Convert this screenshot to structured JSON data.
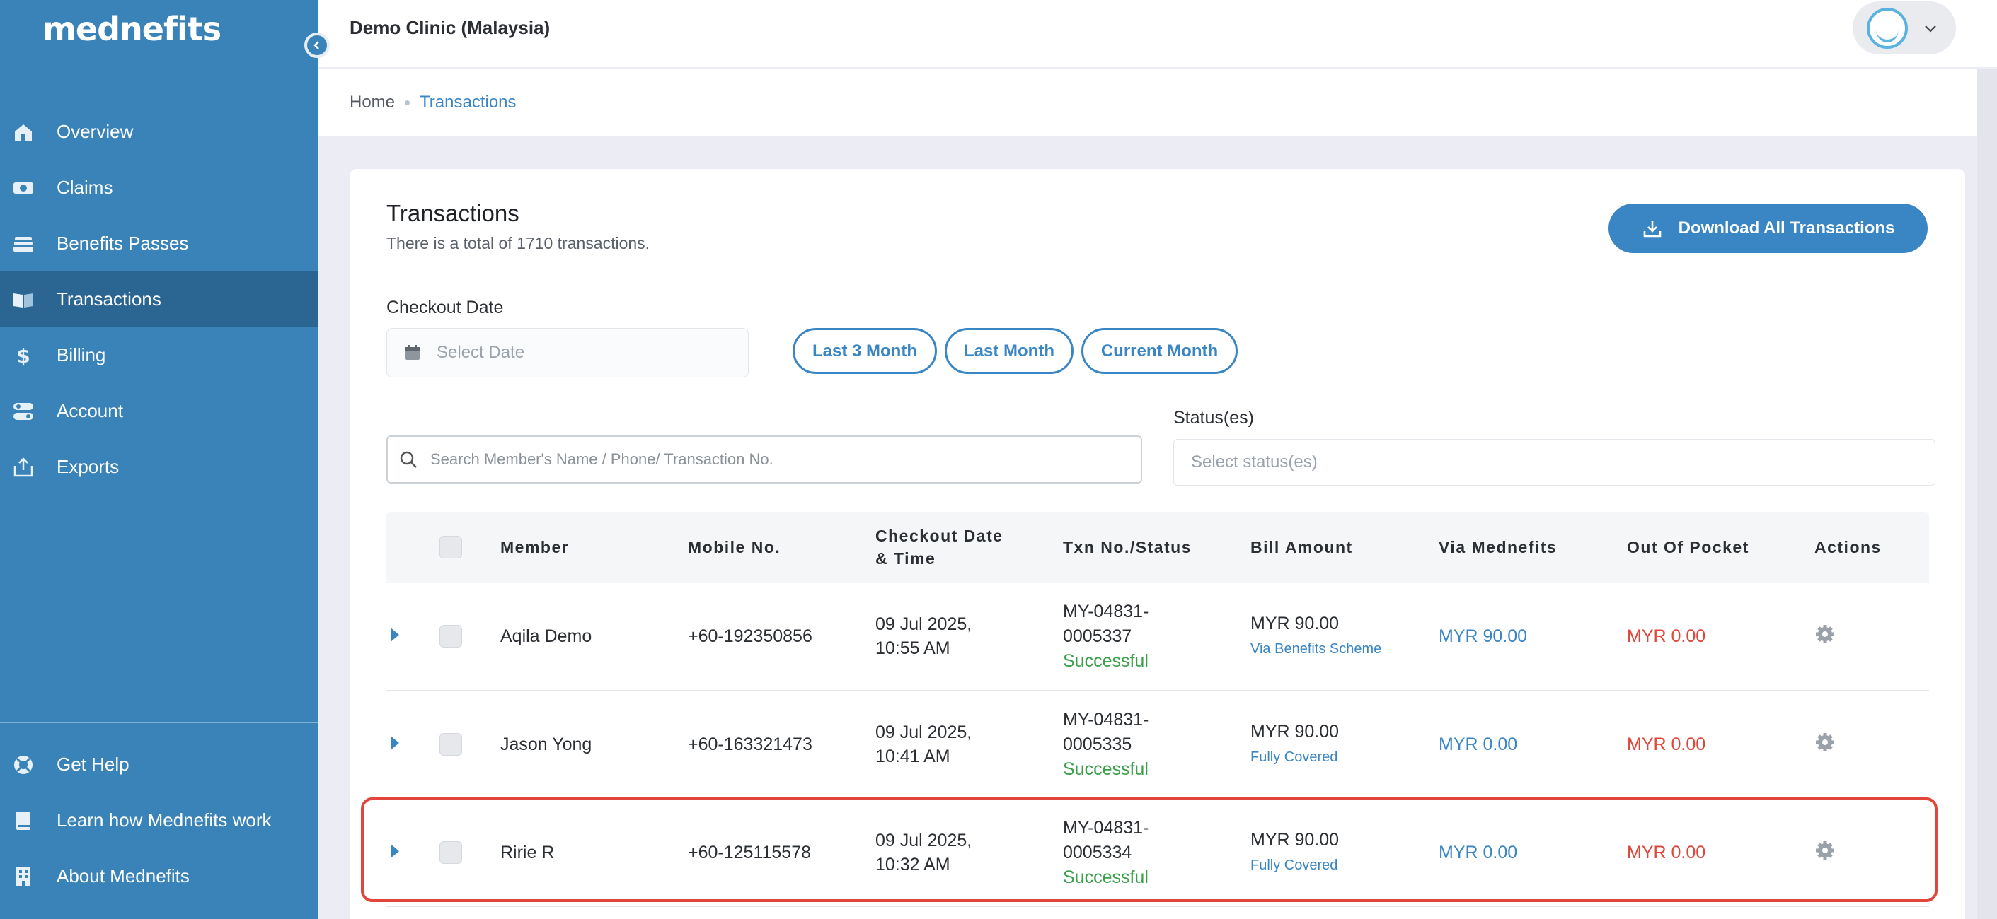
{
  "brand": {
    "logo_text": "mednefits"
  },
  "sidebar": {
    "items": [
      {
        "label": "Overview",
        "icon": "home-icon"
      },
      {
        "label": "Claims",
        "icon": "money-icon"
      },
      {
        "label": "Benefits Passes",
        "icon": "passes-icon"
      },
      {
        "label": "Transactions",
        "icon": "book-icon",
        "active": true
      },
      {
        "label": "Billing",
        "icon": "dollar-icon"
      },
      {
        "label": "Account",
        "icon": "toggle-icon"
      },
      {
        "label": "Exports",
        "icon": "export-icon"
      }
    ],
    "bottom_items": [
      {
        "label": "Get Help",
        "icon": "lifebuoy-icon"
      },
      {
        "label": "Learn how Mednefits work",
        "icon": "book-closed-icon"
      },
      {
        "label": "About Mednefits",
        "icon": "building-icon"
      }
    ]
  },
  "header": {
    "clinic_name": "Demo Clinic (Malaysia)"
  },
  "breadcrumb": {
    "home": "Home",
    "current": "Transactions"
  },
  "page": {
    "title": "Transactions",
    "subtitle": "There is a total of 1710 transactions.",
    "download_label": "Download All Transactions"
  },
  "filters": {
    "checkout_label": "Checkout Date",
    "date_placeholder": "Select Date",
    "quick_ranges": [
      "Last 3 Month",
      "Last Month",
      "Current Month"
    ],
    "search_placeholder": "Search Member's Name / Phone/ Transaction No.",
    "status_label": "Status(es)",
    "status_placeholder": "Select status(es)"
  },
  "table": {
    "headers": {
      "member": "Member",
      "mobile": "Mobile No.",
      "checkout_line1": "Checkout Date",
      "checkout_line2": "& Time",
      "txn": "Txn No./Status",
      "bill": "Bill Amount",
      "via": "Via Mednefits",
      "oop": "Out Of Pocket",
      "actions": "Actions"
    },
    "rows": [
      {
        "member": "Aqila Demo",
        "mobile": "+60-192350856",
        "date": "09 Jul 2025,",
        "time": "10:55 AM",
        "txn1": "MY-04831-",
        "txn2": "0005337",
        "status": "Successful",
        "bill": "MYR 90.00",
        "bill_note": "Via Benefits Scheme",
        "via": "MYR 90.00",
        "oop": "MYR 0.00"
      },
      {
        "member": "Jason Yong",
        "mobile": "+60-163321473",
        "date": "09 Jul 2025,",
        "time": "10:41 AM",
        "txn1": "MY-04831-",
        "txn2": "0005335",
        "status": "Successful",
        "bill": "MYR 90.00",
        "bill_note": "Fully Covered",
        "via": "MYR 0.00",
        "oop": "MYR 0.00"
      },
      {
        "member": "Ririe R",
        "mobile": "+60-125115578",
        "date": "09 Jul 2025,",
        "time": "10:32 AM",
        "txn1": "MY-04831-",
        "txn2": "0005334",
        "status": "Successful",
        "bill": "MYR 90.00",
        "bill_note": "Fully Covered",
        "via": "MYR 0.00",
        "oop": "MYR 0.00"
      }
    ]
  },
  "colors": {
    "sidebar": "#3a83b8",
    "sidebar_active": "#2b6592",
    "accent": "#3a86c4",
    "success": "#3aa04a",
    "danger": "#e0453a",
    "highlight": "#e2463b"
  }
}
